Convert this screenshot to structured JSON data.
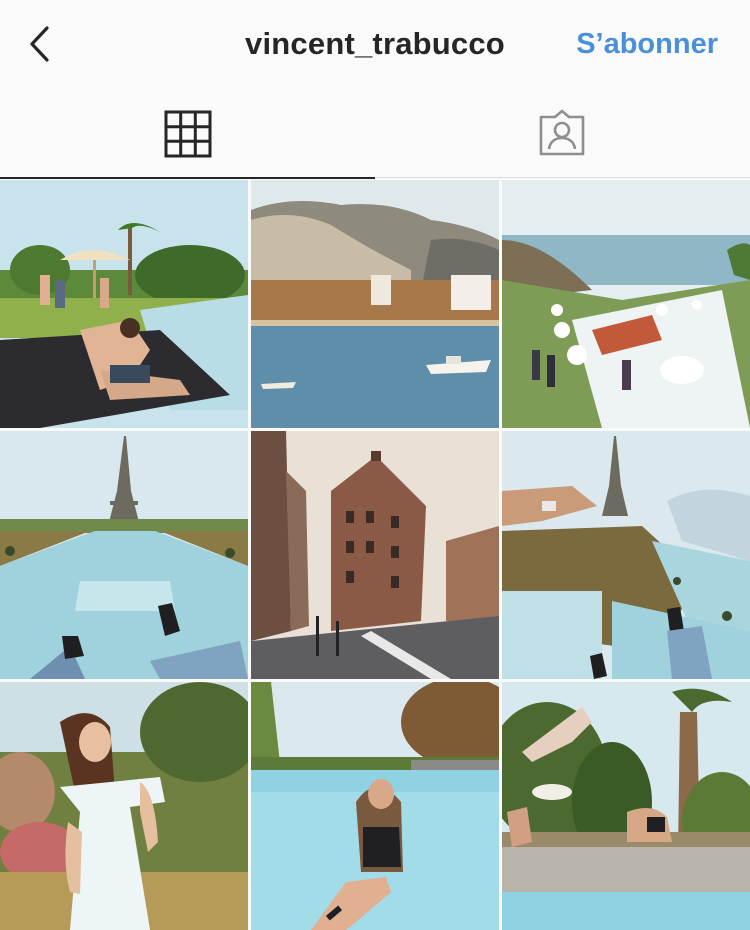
{
  "header": {
    "back_icon": "chevron-left-icon",
    "username": "vincent_trabucco",
    "follow_label": "S’abonner",
    "follow_color": "#4a90d9"
  },
  "tabs": [
    {
      "name": "posts-grid",
      "icon": "grid-icon",
      "active": true
    },
    {
      "name": "tagged",
      "icon": "tagged-user-icon",
      "active": false
    }
  ],
  "posts": [
    {
      "subject": "pool-party-lawn"
    },
    {
      "subject": "coastal-bay-boat"
    },
    {
      "subject": "rooftop-terrace-sea"
    },
    {
      "subject": "eiffel-tower-fountains"
    },
    {
      "subject": "paris-street-building"
    },
    {
      "subject": "eiffel-tower-hand"
    },
    {
      "subject": "woman-white-dress"
    },
    {
      "subject": "follow-me-pool"
    },
    {
      "subject": "pool-backflip"
    }
  ]
}
